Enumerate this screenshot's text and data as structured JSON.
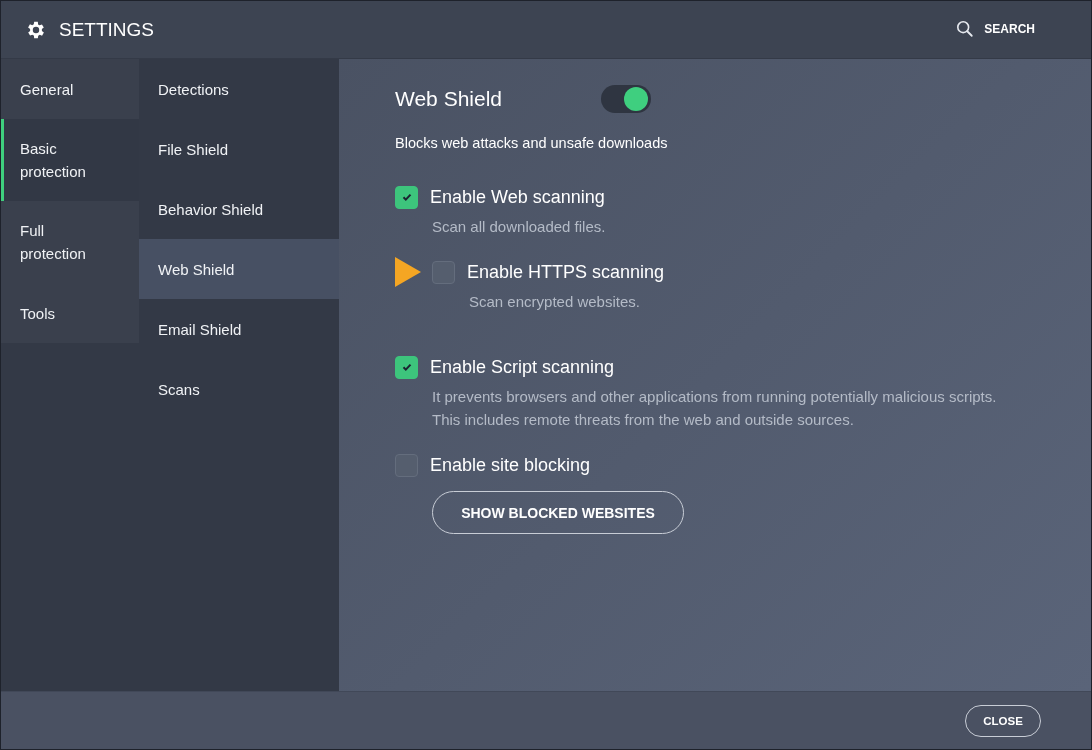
{
  "window": {
    "title": "SETTINGS"
  },
  "search": {
    "label": "SEARCH"
  },
  "categories": [
    {
      "label": "General",
      "selected": false
    },
    {
      "label": "Basic protection",
      "selected": true
    },
    {
      "label": "Full protection",
      "selected": false
    },
    {
      "label": "Tools",
      "selected": false
    }
  ],
  "sections": [
    {
      "label": "Detections",
      "selected": false
    },
    {
      "label": "File Shield",
      "selected": false
    },
    {
      "label": "Behavior Shield",
      "selected": false
    },
    {
      "label": "Web Shield",
      "selected": true
    },
    {
      "label": "Email Shield",
      "selected": false
    },
    {
      "label": "Scans",
      "selected": false
    }
  ],
  "panel": {
    "title": "Web Shield",
    "on": true,
    "description": "Blocks web attacks and unsafe downloads",
    "options": [
      {
        "label": "Enable Web scanning",
        "checked": true,
        "hint": "Scan all downloaded files.",
        "children": [
          {
            "label": "Enable HTTPS scanning",
            "checked": false,
            "highlighted": true,
            "hint": "Scan encrypted websites."
          }
        ]
      },
      {
        "label": "Enable Script scanning",
        "checked": true,
        "hint": "It prevents browsers and other applications from running potentially malicious scripts. This includes remote threats from the web and outside sources."
      },
      {
        "label": "Enable site blocking",
        "checked": false,
        "button": "SHOW BLOCKED WEBSITES"
      }
    ]
  },
  "footer": {
    "button": "CLOSE"
  }
}
